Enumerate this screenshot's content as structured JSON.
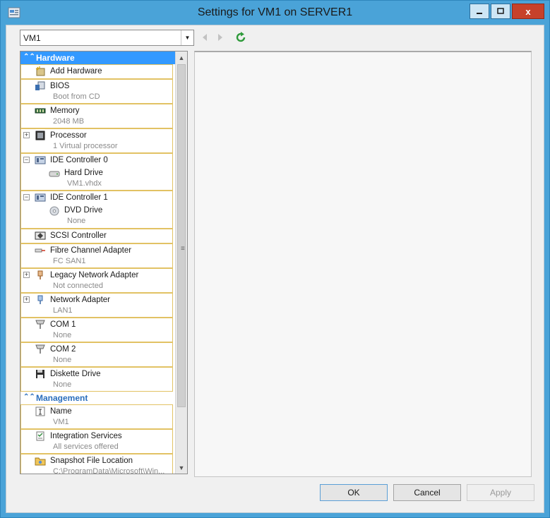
{
  "window": {
    "title": "Settings for VM1 on SERVER1",
    "close_glyph": "x"
  },
  "vm_selector": {
    "value": "VM1"
  },
  "hardware_section": {
    "label": "Hardware"
  },
  "hardware_items": [
    {
      "name": "Add Hardware",
      "sub": ""
    },
    {
      "name": "BIOS",
      "sub": "Boot from CD"
    },
    {
      "name": "Memory",
      "sub": "2048 MB"
    },
    {
      "name": "Processor",
      "sub": "1 Virtual processor"
    },
    {
      "name": "IDE Controller 0",
      "child": "Hard Drive",
      "sub": "VM1.vhdx"
    },
    {
      "name": "IDE Controller 1",
      "child": "DVD Drive",
      "sub": "None"
    },
    {
      "name": "SCSI Controller",
      "sub": ""
    },
    {
      "name": "Fibre Channel Adapter",
      "sub": "FC SAN1"
    },
    {
      "name": "Legacy Network Adapter",
      "sub": "Not connected"
    },
    {
      "name": "Network Adapter",
      "sub": "LAN1"
    },
    {
      "name": "COM 1",
      "sub": "None"
    },
    {
      "name": "COM 2",
      "sub": "None"
    },
    {
      "name": "Diskette Drive",
      "sub": "None"
    }
  ],
  "management_section": {
    "label": "Management"
  },
  "management_items": [
    {
      "name": "Name",
      "sub": "VM1"
    },
    {
      "name": "Integration Services",
      "sub": "All services offered"
    },
    {
      "name": "Snapshot File Location",
      "sub": "C:\\ProgramData\\Microsoft\\Win..."
    }
  ],
  "buttons": {
    "ok": "OK",
    "cancel": "Cancel",
    "apply": "Apply"
  },
  "colors": {
    "hardware_header": "#3399ff",
    "management_header_text": "#2a6ebd",
    "item_border": "#e2c264",
    "close_button": "#c7412a"
  }
}
